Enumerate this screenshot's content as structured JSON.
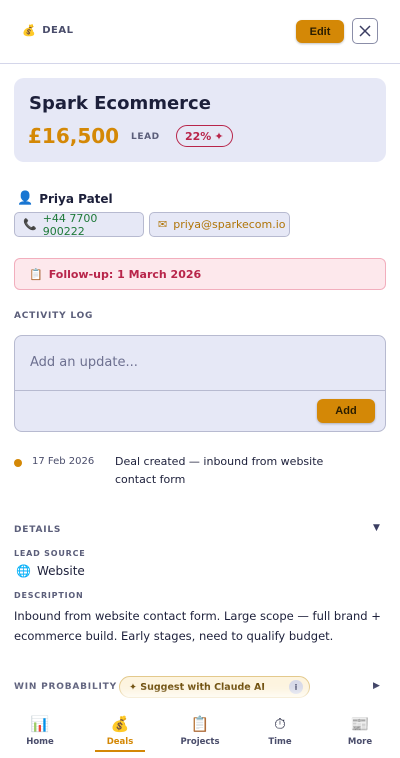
{
  "header": {
    "crumb_icon": "money-bag-icon",
    "crumb_label": "DEAL",
    "edit_label": "Edit"
  },
  "deal": {
    "title": "Spark Ecommerce",
    "value": "£16,500",
    "stage": "LEAD",
    "probability": "22%"
  },
  "contact": {
    "name": "Priya Patel",
    "phone": "+44 7700 900222",
    "email": "priya@sparkecom.io"
  },
  "followup": {
    "text": "Follow-up: 1 March 2026"
  },
  "activity": {
    "label": "ACTIVITY LOG",
    "placeholder": "Add an update...",
    "add_label": "Add",
    "entries": [
      {
        "date": "17 Feb 2026",
        "text": "Deal created — inbound from website contact form"
      }
    ]
  },
  "details": {
    "label": "DETAILS",
    "lead_source_label": "LEAD SOURCE",
    "lead_source": "Website",
    "description_label": "DESCRIPTION",
    "description": "Inbound from website contact form. Large scope — full brand + ecommerce build. Early stages, need to qualify budget."
  },
  "win_probability": {
    "label": "WIN PROBABILITY",
    "suggest_label": "✦ Suggest with Claude AI",
    "info_icon": "info-icon"
  },
  "tabs": [
    {
      "label": "Home",
      "icon": "chart-icon"
    },
    {
      "label": "Deals",
      "icon": "money-bag-icon"
    },
    {
      "label": "Projects",
      "icon": "clipboard-icon"
    },
    {
      "label": "Time",
      "icon": "stopwatch-icon"
    },
    {
      "label": "More",
      "icon": "newspaper-icon"
    }
  ],
  "colors": {
    "accent": "#d48806",
    "danger": "#b8254a",
    "card_bg": "#e6e8f6",
    "success": "#1f7a3a"
  }
}
